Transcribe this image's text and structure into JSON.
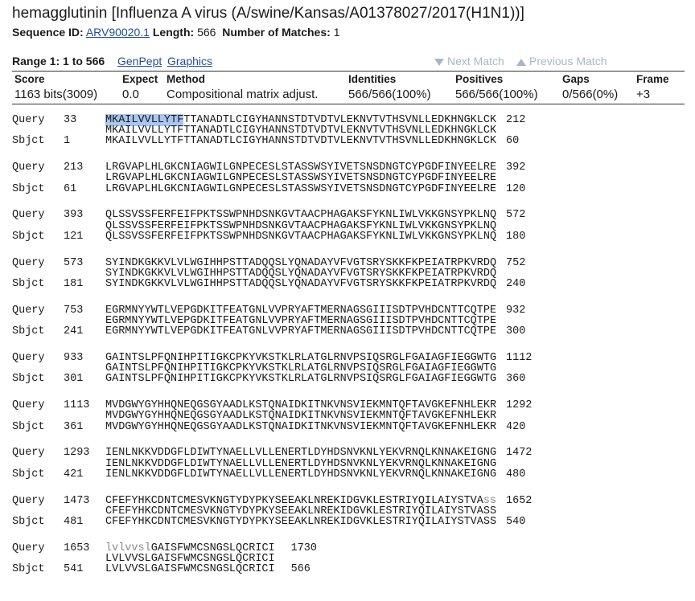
{
  "title": "hemagglutinin [Influenza A virus (A/swine/Kansas/A01378027/2017(H1N1))]",
  "meta": {
    "seqid_label": "Sequence ID:",
    "seqid_value": "ARV90020.1",
    "length_label": "Length:",
    "length_value": "566",
    "matches_label": "Number of Matches:",
    "matches_value": "1"
  },
  "range": {
    "label": "Range 1: 1 to 566",
    "genpept": "GenPept",
    "graphics": "Graphics",
    "next_match": "Next Match",
    "previous_match": "Previous Match"
  },
  "score_table": {
    "headers": [
      "Score",
      "Expect",
      "Method",
      "Identities",
      "Positives",
      "Gaps",
      "Frame"
    ],
    "values": [
      "1163 bits(3009)",
      "0.0",
      "Compositional matrix adjust.",
      "566/566(100%)",
      "566/566(100%)",
      "0/566(0%)",
      "+3"
    ]
  },
  "alignment": {
    "query_label": "Query",
    "sbjct_label": "Sbjct",
    "blocks": [
      {
        "q_start": "33",
        "q_hl": "MKAILVVLLYTF",
        "q_seq": "TTANADTLCIGYHANNSTDTVDTVLEKNVTVTHSVNLLEDKHNGKLCK",
        "q_end": "212",
        "mid": "MKAILVVLLYTFTTANADTLCIGYHANNSTDTVDTVLEKNVTVTHSVNLLEDKHNGKLCK",
        "s_start": "1",
        "s_seq": "MKAILVVLLYTFTTANADTLCIGYHANNSTDTVDTVLEKNVTVTHSVNLLEDKHNGKLCK",
        "s_end": "60"
      },
      {
        "q_start": "213",
        "q_seq": "LRGVAPLHLGKCNIAGWILGNPECESLSTASSWSYIVETSNSDNGTCYPGDFINYEELRE",
        "q_end": "392",
        "mid": "LRGVAPLHLGKCNIAGWILGNPECESLSTASSWSYIVETSNSDNGTCYPGDFINYEELRE",
        "s_start": "61",
        "s_seq": "LRGVAPLHLGKCNIAGWILGNPECESLSTASSWSYIVETSNSDNGTCYPGDFINYEELRE",
        "s_end": "120"
      },
      {
        "q_start": "393",
        "q_seq": "QLSSVSSFERFEIFPKTSSWPNHDSNKGVTAACPHAGAKSFYKNLIWLVKKGNSYPKLNQ",
        "q_end": "572",
        "mid": "QLSSVSSFERFEIFPKTSSWPNHDSNKGVTAACPHAGAKSFYKNLIWLVKKGNSYPKLNQ",
        "s_start": "121",
        "s_seq": "QLSSVSSFERFEIFPKTSSWPNHDSNKGVTAACPHAGAKSFYKNLIWLVKKGNSYPKLNQ",
        "s_end": "180"
      },
      {
        "q_start": "573",
        "q_seq": "SYINDKGKKVLVLWGIHHPSTTADQQSLYQNADAYVFVGTSRYSKKFKPEIATRPKVRDQ",
        "q_end": "752",
        "mid": "SYINDKGKKVLVLWGIHHPSTTADQQSLYQNADAYVFVGTSRYSKKFKPEIATRPKVRDQ",
        "s_start": "181",
        "s_seq": "SYINDKGKKVLVLWGIHHPSTTADQQSLYQNADAYVFVGTSRYSKKFKPEIATRPKVRDQ",
        "s_end": "240"
      },
      {
        "q_start": "753",
        "q_seq": "EGRMNYYWTLVEPGDKITFEATGNLVVPRYAFTMERNAGSGIIISDTPVHDCNTTCQTPE",
        "q_end": "932",
        "mid": "EGRMNYYWTLVEPGDKITFEATGNLVVPRYAFTMERNAGSGIIISDTPVHDCNTTCQTPE",
        "s_start": "241",
        "s_seq": "EGRMNYYWTLVEPGDKITFEATGNLVVPRYAFTMERNAGSGIIISDTPVHDCNTTCQTPE",
        "s_end": "300"
      },
      {
        "q_start": "933",
        "q_seq": "GAINTSLPFQNIHPITIGKCPKYVKSTKLRLATGLRNVPSIQSRGLFGAIAGFIEGGWTG",
        "q_end": "1112",
        "mid": "GAINTSLPFQNIHPITIGKCPKYVKSTKLRLATGLRNVPSIQSRGLFGAIAGFIEGGWTG",
        "s_start": "301",
        "s_seq": "GAINTSLPFQNIHPITIGKCPKYVKSTKLRLATGLRNVPSIQSRGLFGAIAGFIEGGWTG",
        "s_end": "360"
      },
      {
        "q_start": "1113",
        "q_seq": "MVDGWYGYHHQNEQGSGYAADLKSTQNAIDKITNKVNSVIEKMNTQFTAVGKEFNHLEKR",
        "q_end": "1292",
        "mid": "MVDGWYGYHHQNEQGSGYAADLKSTQNAIDKITNKVNSVIEKMNTQFTAVGKEFNHLEKR",
        "s_start": "361",
        "s_seq": "MVDGWYGYHHQNEQGSGYAADLKSTQNAIDKITNKVNSVIEKMNTQFTAVGKEFNHLEKR",
        "s_end": "420"
      },
      {
        "q_start": "1293",
        "q_seq": "IENLNKKVDDGFLDIWTYNAELLVLLENERTLDYHDSNVKNLYEKVRNQLKNNAKEIGNG",
        "q_end": "1472",
        "mid": "IENLNKKVDDGFLDIWTYNAELLVLLENERTLDYHDSNVKNLYEKVRNQLKNNAKEIGNG",
        "s_start": "421",
        "s_seq": "IENLNKKVDDGFLDIWTYNAELLVLLENERTLDYHDSNVKNLYEKVRNQLKNNAKEIGNG",
        "s_end": "480"
      },
      {
        "q_start": "1473",
        "q_seq": "CFEFYHKCDNTCMESVKNGTYDYPKYSEEAKLNREKIDGVKLESTRIYQILAIYSTVA",
        "q_tail": "ss",
        "q_end": "1652",
        "mid": "CFEFYHKCDNTCMESVKNGTYDYPKYSEEAKLNREKIDGVKLESTRIYQILAIYSTVASS",
        "s_start": "481",
        "s_seq": "CFEFYHKCDNTCMESVKNGTYDYPKYSEEAKLNREKIDGVKLESTRIYQILAIYSTVASS",
        "s_end": "540"
      },
      {
        "q_start": "1653",
        "q_head": "lvlvvsl",
        "q_seq": "GAISFWMCSNGSLQCRICI",
        "q_end": "1730",
        "mid": "LVLVVSLGAISFWMCSNGSLQCRICI",
        "s_start": "541",
        "s_seq": "LVLVVSLGAISFWMCSNGSLQCRICI",
        "s_end": "566"
      }
    ]
  }
}
